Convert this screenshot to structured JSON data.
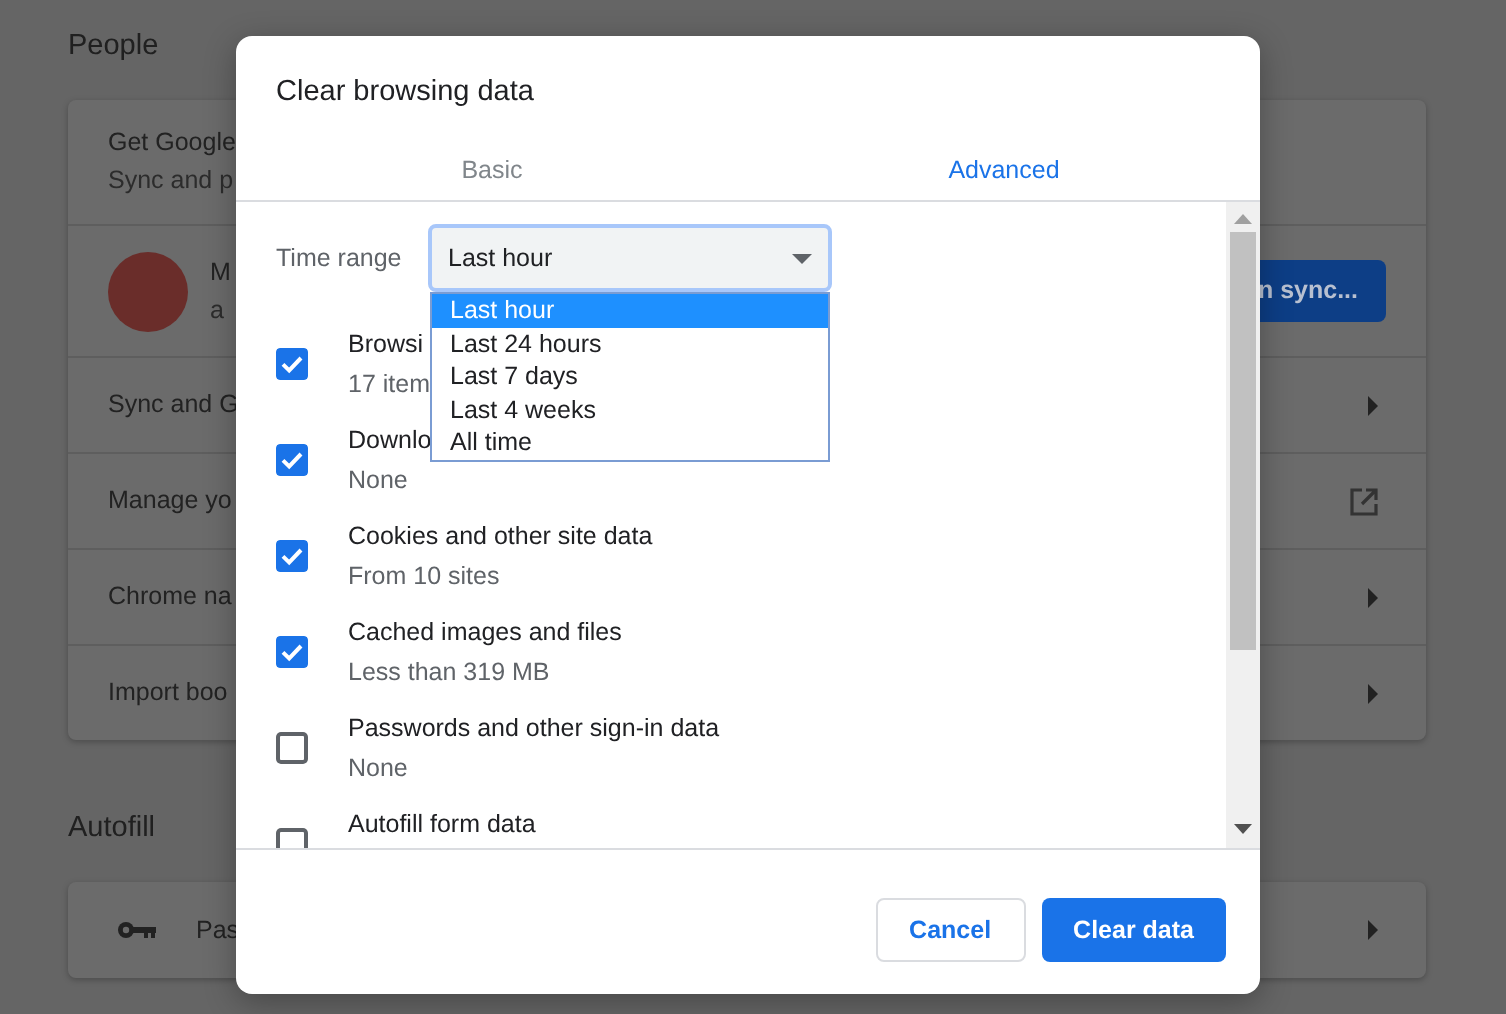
{
  "settings": {
    "sections": [
      {
        "title": "People",
        "rows": [
          {
            "kind": "promo",
            "title": "Get Google",
            "subtitle": "Sync and p"
          },
          {
            "kind": "account",
            "name": "M",
            "email": "a",
            "button": "n sync..."
          },
          {
            "kind": "link",
            "label": "Sync and G"
          },
          {
            "kind": "external",
            "label": "Manage yo"
          },
          {
            "kind": "link",
            "label": "Chrome na"
          },
          {
            "kind": "link",
            "label": "Import boo"
          }
        ]
      },
      {
        "title": "Autofill",
        "rows": [
          {
            "kind": "key_link",
            "label": "Pas"
          }
        ]
      }
    ]
  },
  "dialog": {
    "title": "Clear browsing data",
    "tabs": [
      {
        "label": "Basic",
        "selected": false
      },
      {
        "label": "Advanced",
        "selected": true
      }
    ],
    "time_range": {
      "label": "Time range",
      "value": "Last hour",
      "expanded": true,
      "options": [
        {
          "label": "Last hour",
          "selected": true
        },
        {
          "label": "Last 24 hours",
          "selected": false
        },
        {
          "label": "Last 7 days",
          "selected": false
        },
        {
          "label": "Last 4 weeks",
          "selected": false
        },
        {
          "label": "All time",
          "selected": false
        }
      ]
    },
    "items": [
      {
        "title": "Browsi",
        "detail": "17 item",
        "checked": true
      },
      {
        "title": "Downlo",
        "detail": "None",
        "checked": true
      },
      {
        "title": "Cookies and other site data",
        "detail": "From 10 sites",
        "checked": true
      },
      {
        "title": "Cached images and files",
        "detail": "Less than 319 MB",
        "checked": true
      },
      {
        "title": "Passwords and other sign-in data",
        "detail": "None",
        "checked": false
      },
      {
        "title": "Autofill form data",
        "checked": false
      }
    ],
    "buttons": [
      {
        "label": "Cancel",
        "kind": "secondary"
      },
      {
        "label": "Clear data",
        "kind": "primary"
      }
    ]
  }
}
